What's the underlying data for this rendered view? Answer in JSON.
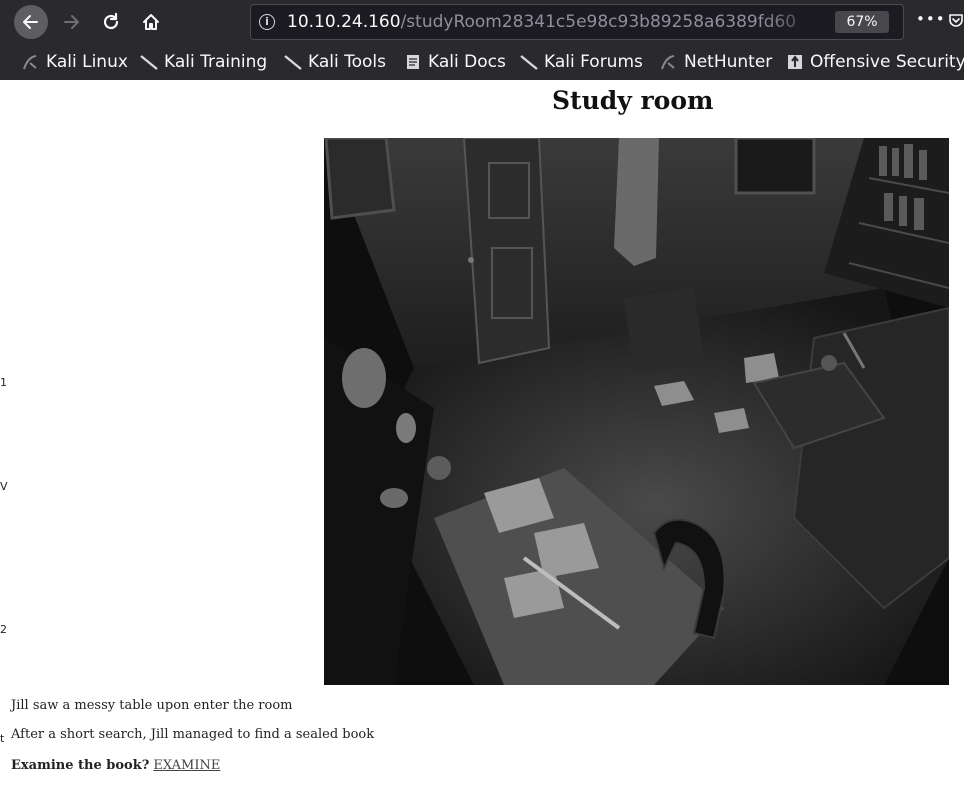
{
  "browser": {
    "url_host": "10.10.24.160",
    "url_path": "/studyRoom28341c5e98c93b89258a6389fd60",
    "zoom": "67%",
    "more_label": "•••",
    "bookmarks": [
      {
        "label": "Kali Linux",
        "icon": "kali-dragon-icon"
      },
      {
        "label": "Kali Training",
        "icon": "kali-dragon-icon"
      },
      {
        "label": "Kali Tools",
        "icon": "kali-dragon-icon"
      },
      {
        "label": "Kali Docs",
        "icon": "docs-icon"
      },
      {
        "label": "Kali Forums",
        "icon": "kali-dragon-icon"
      },
      {
        "label": "NetHunter",
        "icon": "kali-dragon-icon"
      },
      {
        "label": "Offensive Security",
        "icon": "offsec-icon"
      }
    ]
  },
  "page": {
    "title": "Study room",
    "image_alt": "Study room",
    "left_clipped_chars": [
      "1",
      "V",
      "2",
      "t"
    ],
    "lines": [
      "Jill saw a messy table upon enter the room",
      "After a short search, Jill managed to find a sealed book"
    ],
    "examine_prompt": "Examine the book?",
    "examine_link": "EXAMINE"
  },
  "colors": {
    "chrome_bg": "#2a2a2e",
    "urlbar_bg": "#1c1b22",
    "page_bg": "#ffffff"
  }
}
